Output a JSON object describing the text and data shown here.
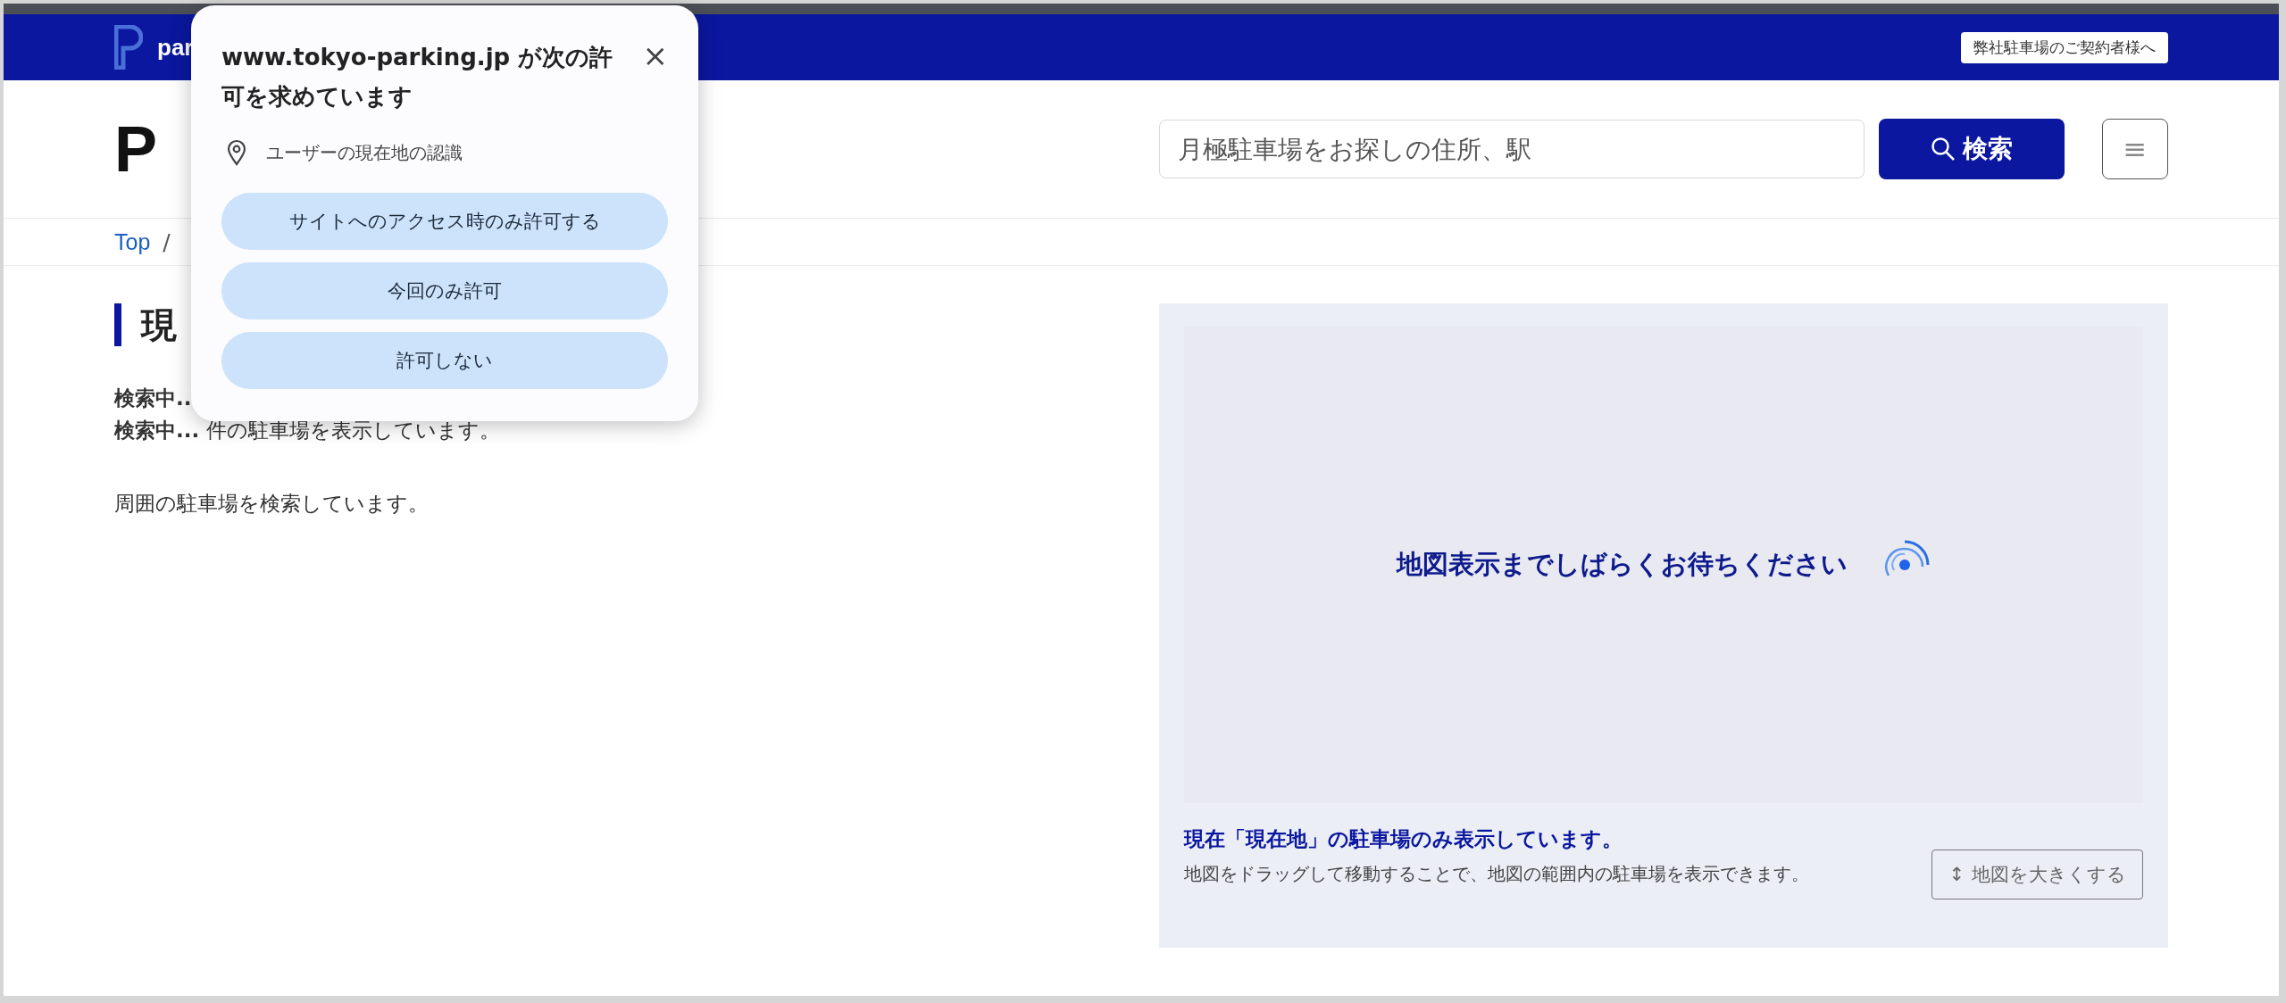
{
  "top_bar": {
    "logo_text": "par",
    "contract_link": "弊社駐車場のご契約者様へ"
  },
  "header": {
    "logo": "P",
    "search": {
      "placeholder": "月極駐車場をお探しの住所、駅"
    },
    "search_button": "検索",
    "menu_button": "≡"
  },
  "breadcrumb": {
    "items": [
      "Top"
    ],
    "separator": "/"
  },
  "heading": "現",
  "results": [
    "**検索中..**",
    "**検索中...** 件の駐車場を表示しています。",
    "周囲の駐車場を検索しています。"
  ],
  "map": {
    "loading_text": "地図表示までしばらくお待ちください",
    "notice": "現在「現在地」の駐車場のみ表示しています。",
    "description": "地図をドラッグして移動することで、地図の範囲内の駐車場を表示できます。",
    "enlarge_icon": "↕",
    "enlarge_button": "地図を大きくする"
  },
  "permission_popup": {
    "title": "www.tokyo-parking.jp が次の許可を求めています",
    "close": "×",
    "permission": "ユーザーの現在地の認識",
    "buttons": [
      "サイトへのアクセス時のみ許可する",
      "今回のみ許可",
      "許可しない"
    ]
  }
}
